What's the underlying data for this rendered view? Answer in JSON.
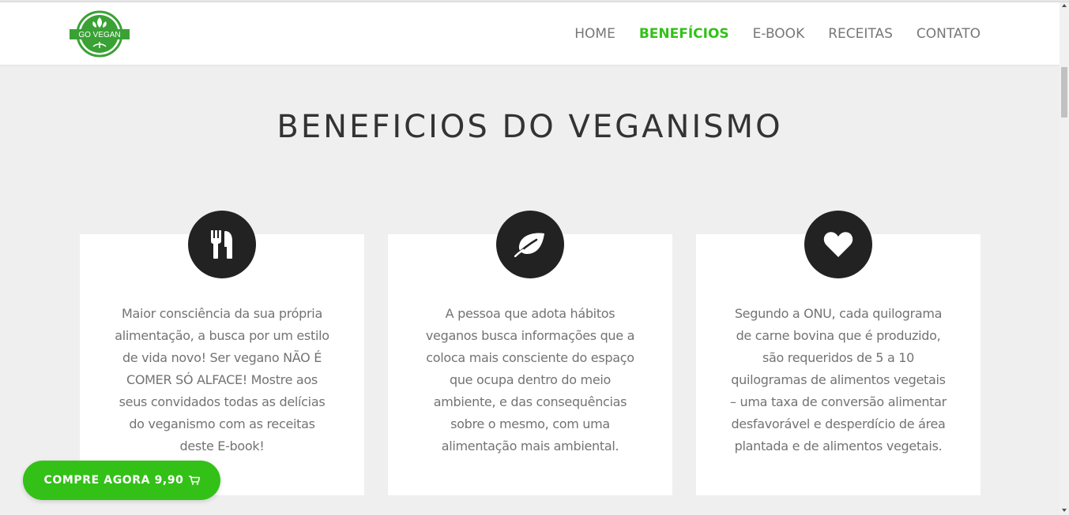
{
  "brand": {
    "logo_text": "GO VEGAN"
  },
  "nav": {
    "items": [
      {
        "label": "HOME",
        "active": false
      },
      {
        "label": "BENEFÍCIOS",
        "active": true
      },
      {
        "label": "E-BOOK",
        "active": false
      },
      {
        "label": "RECEITAS",
        "active": false
      },
      {
        "label": "CONTATO",
        "active": false
      }
    ]
  },
  "section": {
    "title": "BENEFICIOS DO VEGANISMO"
  },
  "cards": [
    {
      "icon": "utensils-icon",
      "text": "Maior consciência da sua própria alimentação, a busca por um estilo de vida novo! Ser vegano NÃO É COMER SÓ ALFACE! Mostre aos seus convidados todas as delícias do veganismo com as receitas deste E-book!"
    },
    {
      "icon": "leaf-icon",
      "text": "A pessoa que adota hábitos veganos busca informações que a coloca mais consciente do espaço que ocupa dentro do meio ambiente, e das consequências sobre o mesmo, com uma alimentação mais ambiental."
    },
    {
      "icon": "heart-icon",
      "text": "Segundo a ONU, cada quilograma de carne bovina que é produzido, são requeridos de 5 a 10 quilogramas de alimentos vegetais – uma taxa de conversão alimentar desfavorável e desperdício de área plantada e de alimentos vegetais."
    }
  ],
  "cta": {
    "label": "COMPRE AGORA 9,90",
    "icon": "shopping-cart-icon"
  },
  "colors": {
    "accent": "#33c118",
    "icon_bg": "#222222",
    "page_bg": "#efefef"
  }
}
